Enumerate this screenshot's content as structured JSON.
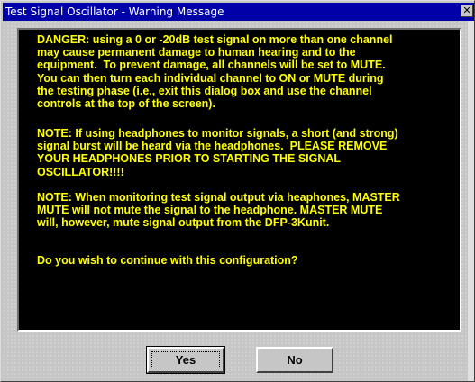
{
  "window": {
    "title": "Test Signal Oscillator - Warning Message",
    "close_glyph": "✕"
  },
  "message": {
    "danger": "DANGER: using a 0 or -20dB test signal on more than one channel\nmay cause permanent damage to human hearing and to the\nequipment.  To prevent damage, all channels will be set to MUTE.\nYou can then turn each individual channel to ON or MUTE during\nthe testing phase (i.e., exit this dialog box and use the channel\ncontrols at the top of the screen).",
    "note_headphones": "NOTE: If using headphones to monitor signals, a short (and strong)\nsignal burst will be heard via the headphones.  PLEASE REMOVE\nYOUR HEADPHONES PRIOR TO STARTING THE SIGNAL\nOSCILLATOR!!!!",
    "note_master_mute": "NOTE: When monitoring test signal output via heaphones, MASTER\nMUTE will not mute the signal to the headphone. MASTER MUTE\nwill, however, mute signal output from the DFP-3Kunit.",
    "question": "Do you wish to continue with this configuration?"
  },
  "buttons": {
    "yes_label": "Yes",
    "no_label": "No"
  },
  "colors": {
    "title_bar": "#0000a8",
    "panel_background": "#000000",
    "message_text": "#ffff00",
    "dialog_face": "#c6c6c6"
  },
  "icons": {
    "close": "close-icon"
  }
}
